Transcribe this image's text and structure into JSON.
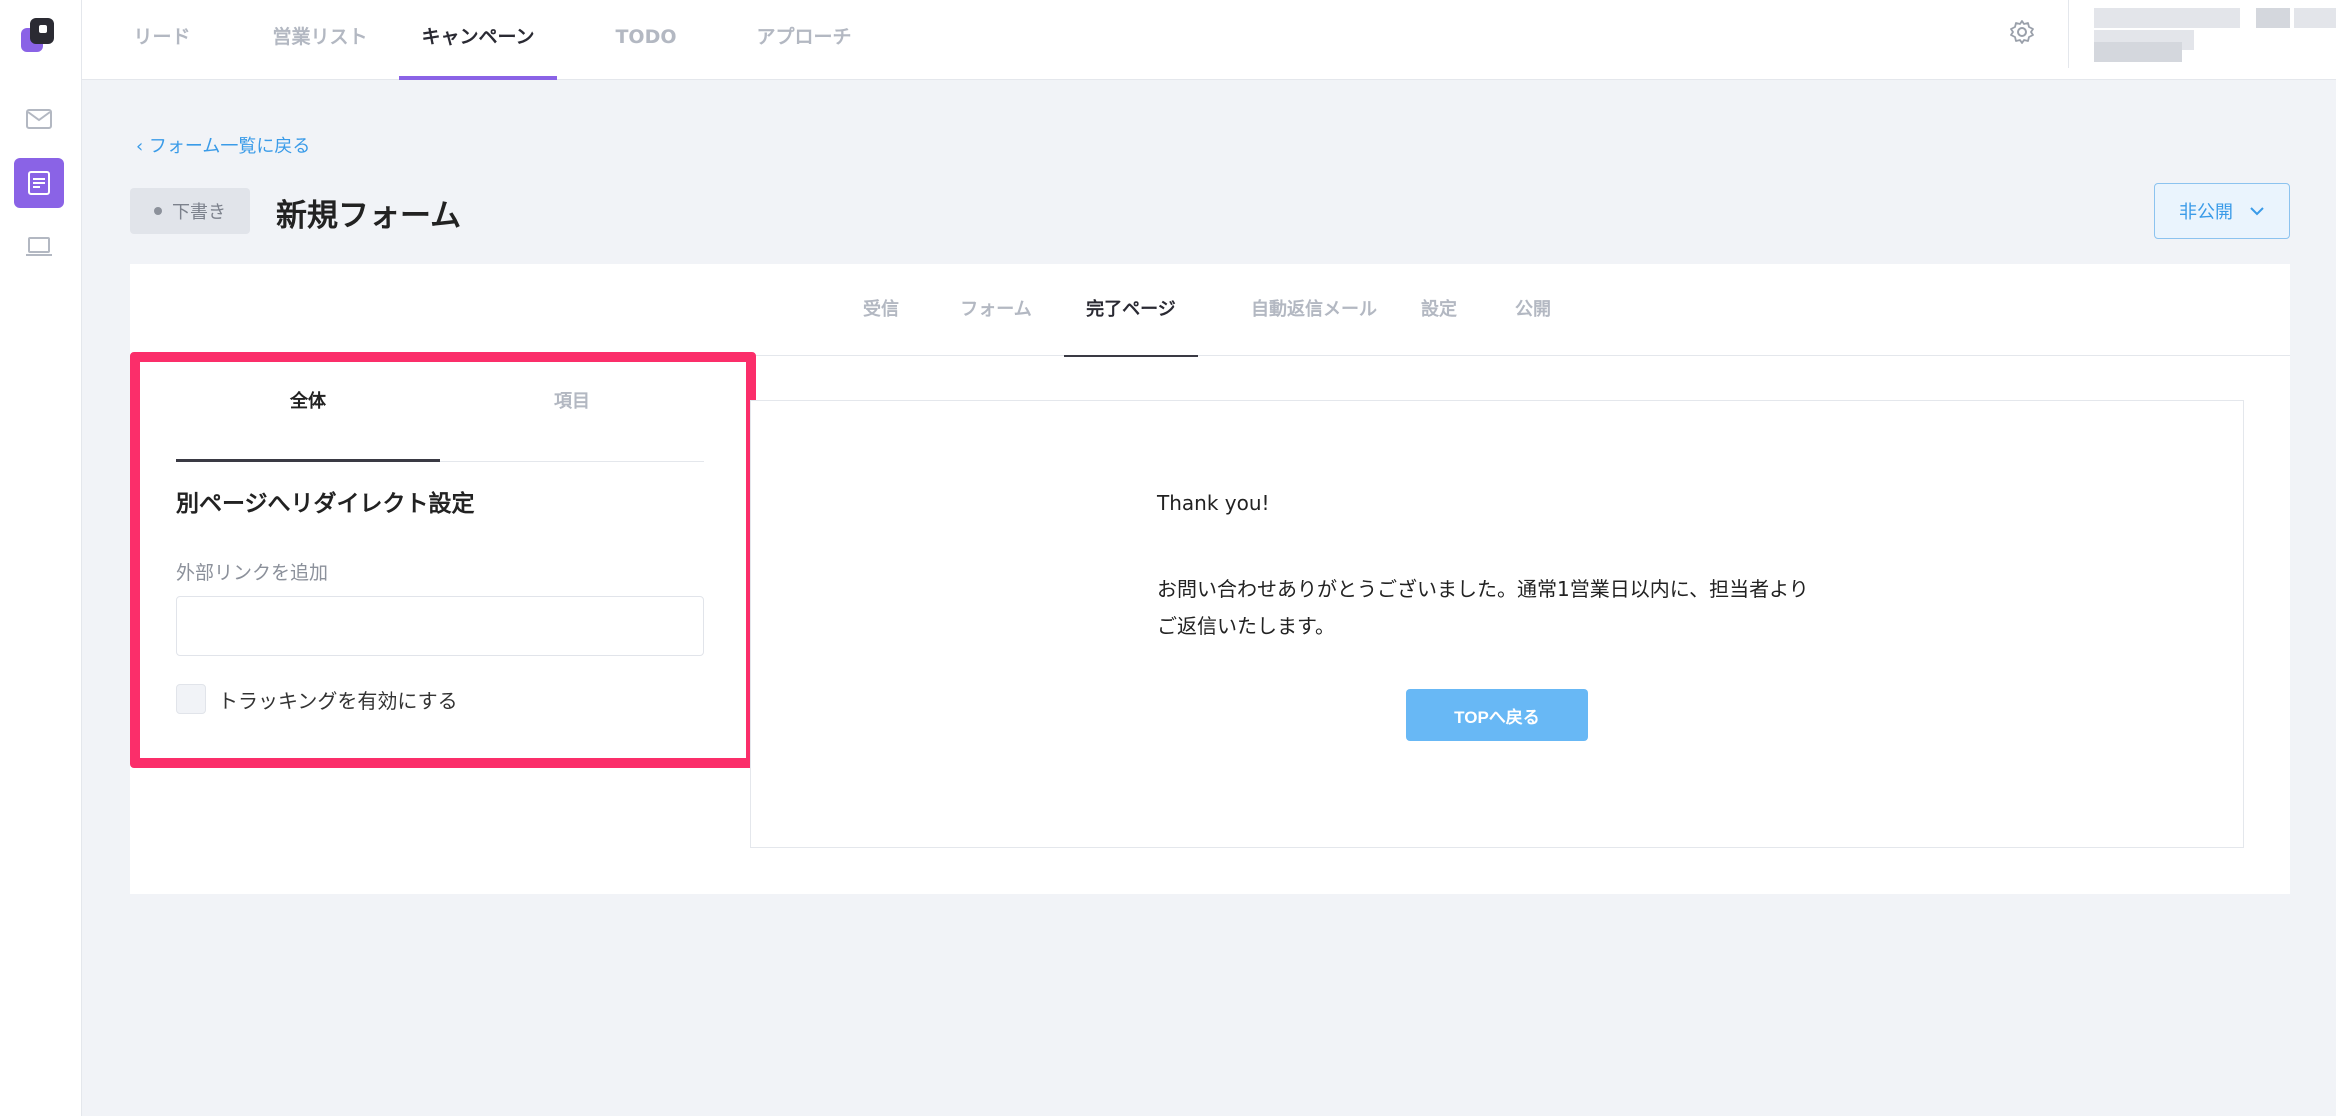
{
  "nav": {
    "tabs": [
      {
        "label": "リード"
      },
      {
        "label": "営業リスト"
      },
      {
        "label": "キャンペーン"
      },
      {
        "label": "TODO"
      },
      {
        "label": "アプローチ"
      }
    ],
    "active_tab": "キャンペーン"
  },
  "rail": {
    "items": [
      "mail-icon",
      "form-icon",
      "laptop-icon"
    ],
    "active": "form-icon"
  },
  "header": {
    "back_link": "フォーム一覧に戻る",
    "status_badge": "下書き",
    "title": "新規フォーム",
    "visibility": "非公開"
  },
  "steps": {
    "tabs": [
      {
        "label": "受信"
      },
      {
        "label": "フォーム"
      },
      {
        "label": "完了ページ"
      },
      {
        "label": "自動返信メール"
      },
      {
        "label": "設定"
      },
      {
        "label": "公開"
      }
    ],
    "active": "完了ページ"
  },
  "settings_panel": {
    "tabs": [
      {
        "label": "全体"
      },
      {
        "label": "項目"
      }
    ],
    "active_tab": "全体",
    "section_title": "別ページへリダイレクト設定",
    "external_link_label": "外部リンクを追加",
    "external_link_value": "",
    "tracking_label": "トラッキングを有効にする",
    "tracking_checked": false
  },
  "preview": {
    "title": "Thank you!",
    "message_line1": "お問い合わせありがとうございました。通常1営業日以内に、担当者より",
    "message_line2": "ご返信いたします。",
    "button_label": "TOPへ戻る"
  },
  "colors": {
    "accent_purple": "#8a63e6",
    "link_blue": "#3a9be8",
    "button_blue": "#68b8f5",
    "highlight_pink": "#fb2e6a"
  }
}
